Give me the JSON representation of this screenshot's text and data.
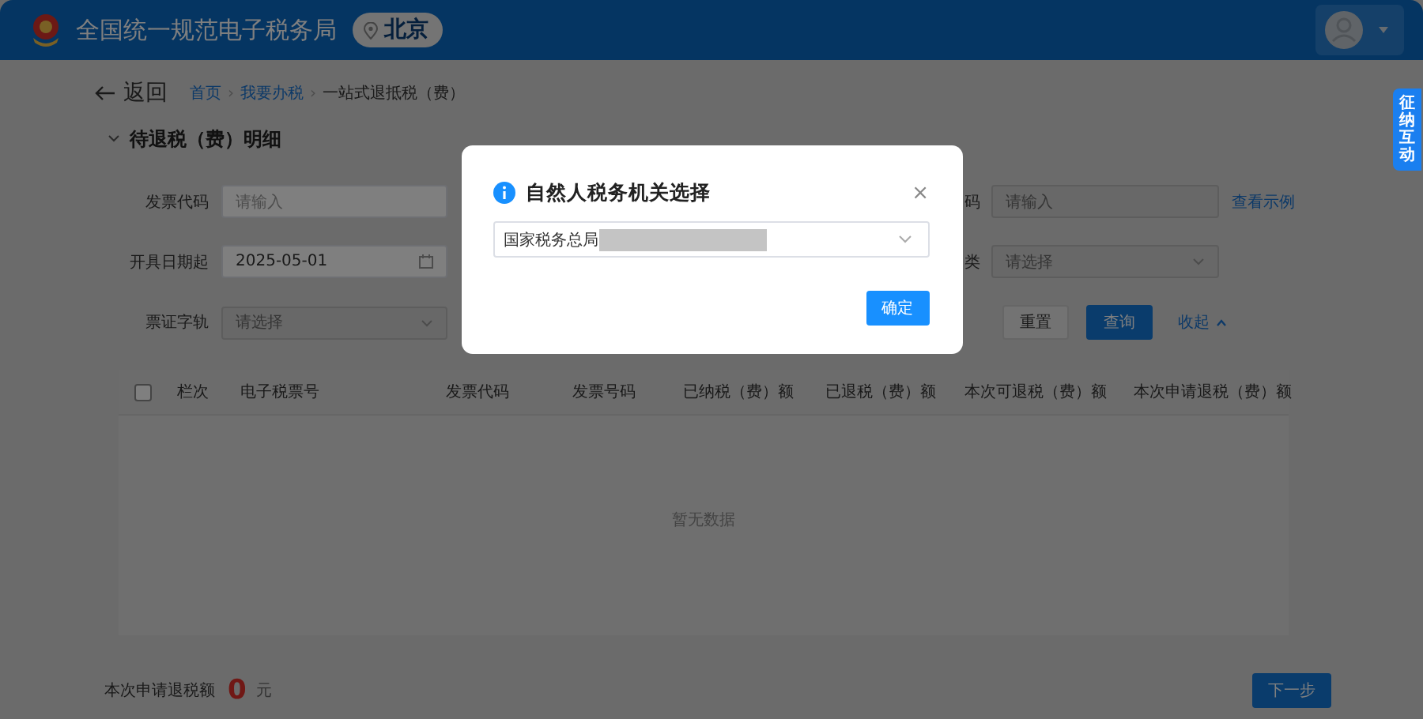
{
  "header": {
    "title": "全国统一规范电子税务局",
    "location": "北京"
  },
  "side_tab": {
    "label": "征纳互动"
  },
  "nav": {
    "back": "返回",
    "separator": "›",
    "breadcrumb": [
      {
        "label": "首页",
        "kind": "link"
      },
      {
        "label": "我要办税",
        "kind": "link"
      },
      {
        "label": "一站式退抵税（费）",
        "kind": "current"
      }
    ]
  },
  "section": {
    "title": "待退税（费）明细",
    "expanded": true
  },
  "filters": [
    {
      "label": "发票代码",
      "kind": "input",
      "placeholder": "请输入",
      "disabled": false
    },
    {
      "label": "码",
      "kind": "input",
      "placeholder": "请输入",
      "disabled": true,
      "link": "查看示例"
    },
    {
      "label": "开具日期起",
      "kind": "date",
      "value": "2025-05-01",
      "disabled": false
    },
    {
      "label": "类",
      "kind": "select",
      "placeholder": "请选择",
      "disabled": true
    },
    {
      "label": "票证字轨",
      "kind": "select",
      "placeholder": "请选择",
      "disabled": true
    }
  ],
  "actions": [
    {
      "label": "重置",
      "kind": "default"
    },
    {
      "label": "查询",
      "kind": "primary"
    },
    {
      "label": "收起",
      "kind": "link"
    }
  ],
  "table": {
    "select_all_checked": false,
    "columns": [
      "栏次",
      "电子税票号",
      "发票代码",
      "发票号码",
      "已纳税（费）额",
      "已退税（费）额",
      "本次可退税（费）额",
      "本次申请退税（费）额"
    ],
    "empty_text": "暂无数据"
  },
  "footer": {
    "label": "本次申请退税额",
    "amount": "0",
    "unit": "元",
    "next": "下一步"
  },
  "dialog": {
    "title": "自然人税务机关选择",
    "close": "×",
    "select_value": "国家税务总局",
    "redacted": true,
    "confirm": "确定"
  }
}
